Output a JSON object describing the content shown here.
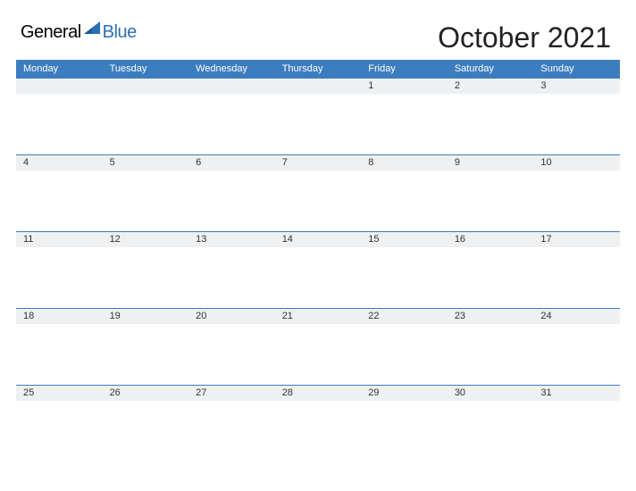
{
  "logo": {
    "text_dark": "General",
    "text_blue": "Blue"
  },
  "title": "October 2021",
  "colors": {
    "accent": "#3c7dc0",
    "strip_bg": "#eef0f2"
  },
  "day_headers": [
    "Monday",
    "Tuesday",
    "Wednesday",
    "Thursday",
    "Friday",
    "Saturday",
    "Sunday"
  ],
  "weeks": [
    [
      "",
      "",
      "",
      "",
      "1",
      "2",
      "3"
    ],
    [
      "4",
      "5",
      "6",
      "7",
      "8",
      "9",
      "10"
    ],
    [
      "11",
      "12",
      "13",
      "14",
      "15",
      "16",
      "17"
    ],
    [
      "18",
      "19",
      "20",
      "21",
      "22",
      "23",
      "24"
    ],
    [
      "25",
      "26",
      "27",
      "28",
      "29",
      "30",
      "31"
    ]
  ]
}
